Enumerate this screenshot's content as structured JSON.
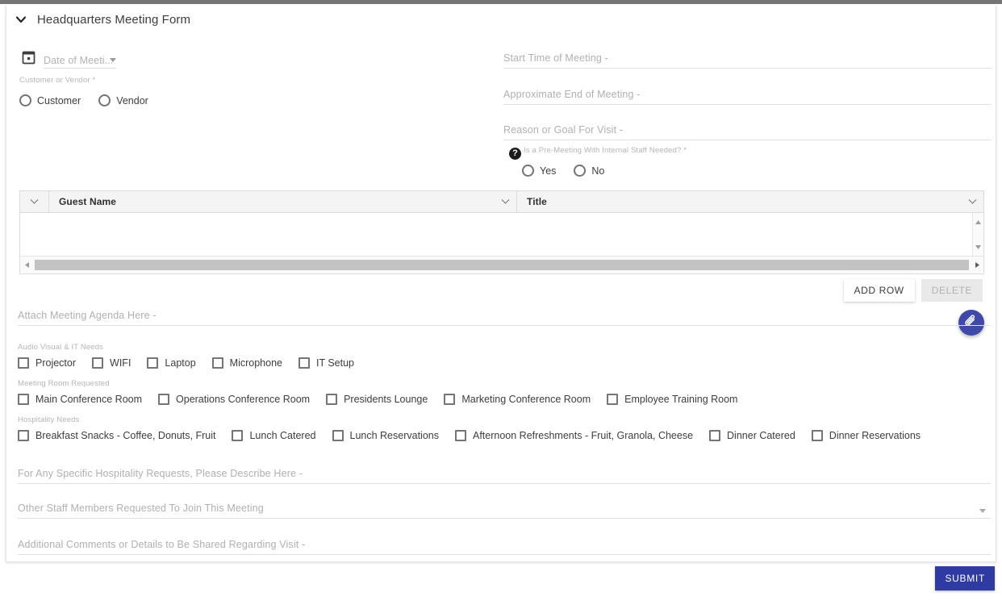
{
  "form": {
    "title": "Headquarters Meeting Form",
    "collapse_icon": "chevron-down-icon"
  },
  "fields": {
    "date_of_meeting": {
      "placeholder": "Date of Meeti...",
      "icon": "calendar-icon"
    },
    "start_time": {
      "placeholder": "Start Time of Meeting -"
    },
    "end_time": {
      "placeholder": "Approximate End of Meeting -"
    },
    "reason": {
      "placeholder": "Reason or Goal For Visit -"
    },
    "attach_agenda": {
      "placeholder": "Attach Meeting Agenda Here -"
    },
    "hospitality_requests": {
      "placeholder": "For Any Specific Hospitality Requests, Please Describe Here -"
    },
    "other_staff": {
      "placeholder": "Other Staff Members Requested To Join This Meeting"
    },
    "additional_comments": {
      "placeholder": "Additional Comments or Details to Be Shared Regarding Visit -"
    }
  },
  "customer_vendor": {
    "label": "Customer or Vendor *",
    "options": [
      {
        "label": "Customer"
      },
      {
        "label": "Vendor"
      }
    ]
  },
  "pre_meeting": {
    "label": "Is a Pre-Meeting With Internal Staff Needed? *",
    "help_icon": "help-question-icon",
    "help_glyph": "?",
    "options": [
      {
        "label": "Yes"
      },
      {
        "label": "No"
      }
    ]
  },
  "guest_grid": {
    "columns": [
      {
        "label": "Guest Name"
      },
      {
        "label": "Title"
      }
    ],
    "rows": []
  },
  "grid_buttons": {
    "add_row": "ADD ROW",
    "delete": "DELETE",
    "delete_disabled": true
  },
  "attachment_fab": {
    "icon": "paperclip-icon"
  },
  "checkbox_groups": [
    {
      "title": "Audio Visual & IT Needs",
      "items": [
        "Projector",
        "WIFI",
        "Laptop",
        "Microphone",
        "IT Setup"
      ]
    },
    {
      "title": "Meeting Room Requested",
      "items": [
        "Main Conference Room",
        "Operations Conference Room",
        "Presidents Lounge",
        "Marketing Conference Room",
        "Employee Training Room"
      ]
    },
    {
      "title": "Hospitality Needs",
      "items": [
        "Breakfast Snacks - Coffee, Donuts, Fruit",
        "Lunch Catered",
        "Lunch Reservations",
        "Afternoon Refreshments - Fruit, Granola, Cheese",
        "Dinner Catered",
        "Dinner Reservations"
      ]
    }
  ],
  "submit": {
    "label": "SUBMIT"
  },
  "colors": {
    "accent": "#2f3ba2",
    "fab": "#3f4aa8",
    "top_bar": "#757575",
    "placeholder": "#b0b0b0"
  }
}
